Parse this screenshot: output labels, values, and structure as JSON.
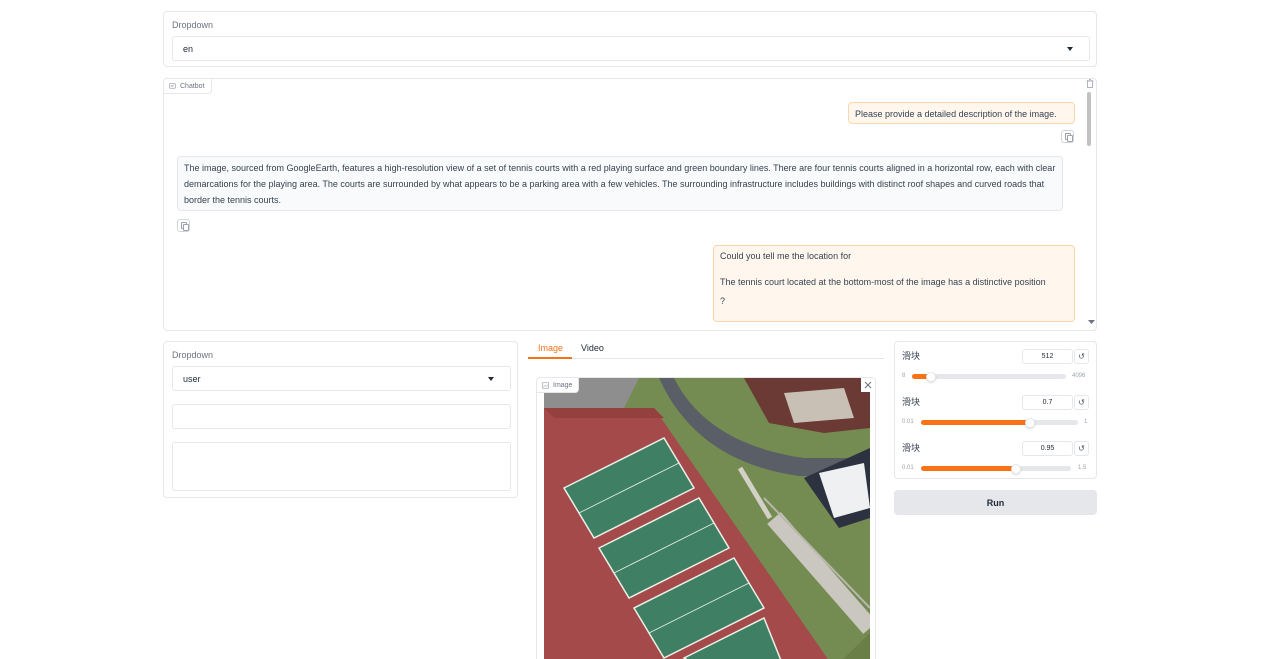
{
  "top_dropdown": {
    "label": "Dropdown",
    "value": "en"
  },
  "chatbot": {
    "label": "Chatbot",
    "messages": [
      {
        "role": "user",
        "text": "Please provide a detailed description of the image."
      },
      {
        "role": "bot",
        "text": "The image, sourced from GoogleEarth, features a high-resolution view of a set of tennis courts with a red playing surface and green boundary lines. There are four tennis courts aligned in a horizontal row, each with clear demarcations for the playing area. The courts are surrounded by what appears to be a parking area with a few vehicles. The surrounding infrastructure includes buildings with distinct roof shapes and curved roads that border the tennis courts."
      },
      {
        "role": "user",
        "text_line1": "Could you tell me the location for",
        "text_line2": "The tennis court located at the bottom-most of the image has a distinctive position",
        "text_line3": "?"
      }
    ]
  },
  "left_panel": {
    "dropdown_label": "Dropdown",
    "dropdown_value": "user"
  },
  "tabs": [
    "Image",
    "Video"
  ],
  "image_panel": {
    "label": "Image"
  },
  "sliders": [
    {
      "title": "滑块",
      "value": "512",
      "min": "8",
      "max": "4096",
      "fraction": 0.123
    },
    {
      "title": "滑块",
      "value": "0.7",
      "min": "0.01",
      "max": "1",
      "fraction": 0.697
    },
    {
      "title": "滑块",
      "value": "0.95",
      "min": "0.01",
      "max": "1.5",
      "fraction": 0.631
    }
  ],
  "run_label": "Run",
  "colors": {
    "accent": "#f97316",
    "user_bubble": "#fff7ed",
    "bot_bubble": "#f9fafb"
  }
}
